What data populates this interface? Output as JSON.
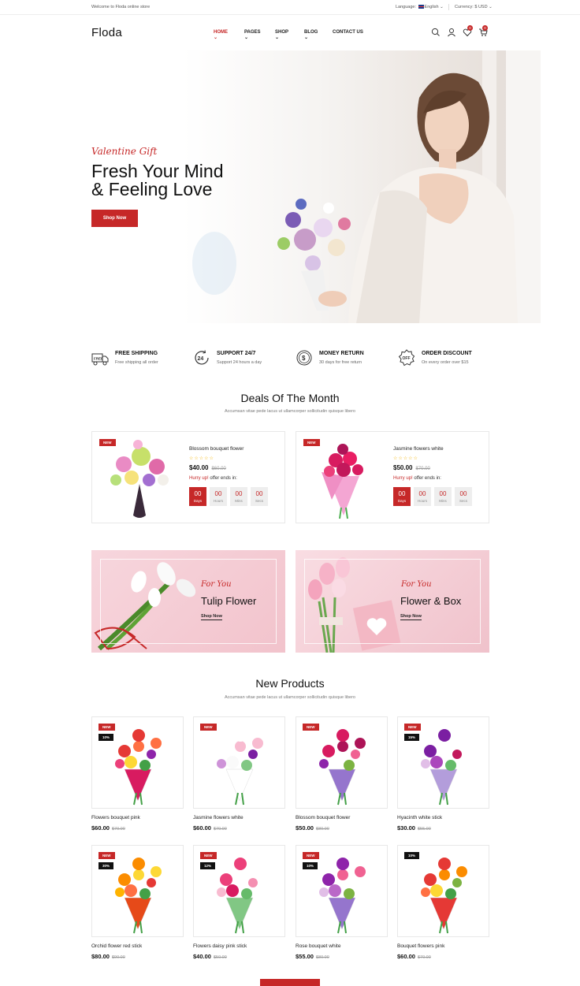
{
  "topbar": {
    "welcome": "Welcome to Floda online store",
    "language_label": "Language:",
    "language_value": "English",
    "currency_label": "Currency:",
    "currency_value": "$ USD"
  },
  "header": {
    "logo": "Floda",
    "nav": [
      {
        "label": "HOME",
        "chev": "⌄"
      },
      {
        "label": "PAGES",
        "chev": "⌄"
      },
      {
        "label": "SHOP",
        "chev": "⌄"
      },
      {
        "label": "BLOG",
        "chev": "⌄"
      },
      {
        "label": "CONTACT US"
      }
    ],
    "wishlist_count": "0",
    "cart_count": "0"
  },
  "hero": {
    "tagline": "Valentine Gift",
    "title_line1": "Fresh Your Mind",
    "title_line2": "& Feeling Love",
    "button": "Shop Now"
  },
  "features": [
    {
      "title": "FREE SHIPPING",
      "desc": "Free shipping all order",
      "icon": "free-shipping-truck-icon"
    },
    {
      "title": "SUPPORT 24/7",
      "desc": "Support 24 hours a day",
      "icon": "support-24-icon"
    },
    {
      "title": "MONEY RETURN",
      "desc": "30 days for free return",
      "icon": "money-return-icon"
    },
    {
      "title": "ORDER DISCOUNT",
      "desc": "On every order over $15",
      "icon": "discount-off-icon"
    }
  ],
  "deals": {
    "title": "Deals Of The Month",
    "subtitle": "Accumsan vitae pede lacus ut ullamcorper sollicitudin quisque libero",
    "items": [
      {
        "badge": "NEW",
        "name": "Blossom bouquet flower",
        "stars": "☆☆☆☆☆",
        "price": "$40.00",
        "old_price": "$60.00",
        "hurry": "Hurry up!",
        "offer": " offer ends in:"
      },
      {
        "badge": "NEW",
        "name": "Jasmine flowers white",
        "stars": "☆☆☆☆☆",
        "price": "$50.00",
        "old_price": "$70.00",
        "hurry": "Hurry up!",
        "offer": " offer ends in:"
      }
    ],
    "timer": [
      {
        "value": "00",
        "label": "Days"
      },
      {
        "value": "00",
        "label": "Hours"
      },
      {
        "value": "00",
        "label": "Mins"
      },
      {
        "value": "00",
        "label": "Secs"
      }
    ]
  },
  "banners": [
    {
      "kicker": "For You",
      "title": "Tulip Flower",
      "link": "Shop Now"
    },
    {
      "kicker": "For You",
      "title": "Flower & Box",
      "link": "Shop Now"
    }
  ],
  "new_products": {
    "title": "New Products",
    "subtitle": "Accumsan vitae pede lacus ut ullamcorper sollicitudin quisque libero",
    "items": [
      {
        "name": "Flowers bouquet pink",
        "price": "$60.00",
        "old_price": "$70.00",
        "badge": "NEW",
        "discount": "10%"
      },
      {
        "name": "Jasmine flowers white",
        "price": "$60.00",
        "old_price": "$70.00",
        "badge": "NEW",
        "discount": ""
      },
      {
        "name": "Blossom bouquet flower",
        "price": "$50.00",
        "old_price": "$80.00",
        "badge": "NEW",
        "discount": ""
      },
      {
        "name": "Hyacinth white stick",
        "price": "$30.00",
        "old_price": "$55.00",
        "badge": "NEW",
        "discount": "15%"
      },
      {
        "name": "Orchid flower red stick",
        "price": "$80.00",
        "old_price": "$90.00",
        "badge": "NEW",
        "discount": "30%"
      },
      {
        "name": "Flowers daisy pink stick",
        "price": "$40.00",
        "old_price": "$50.00",
        "badge": "NEW",
        "discount": "12%"
      },
      {
        "name": "Rose bouquet white",
        "price": "$55.00",
        "old_price": "$80.00",
        "badge": "NEW",
        "discount": "10%"
      },
      {
        "name": "Bouquet flowers pink",
        "price": "$60.00",
        "old_price": "$70.00",
        "badge": "",
        "discount": "10%"
      }
    ]
  },
  "colors": {
    "accent": "#c62828",
    "text": "#111111",
    "muted": "#777777",
    "star": "#f4b400"
  }
}
